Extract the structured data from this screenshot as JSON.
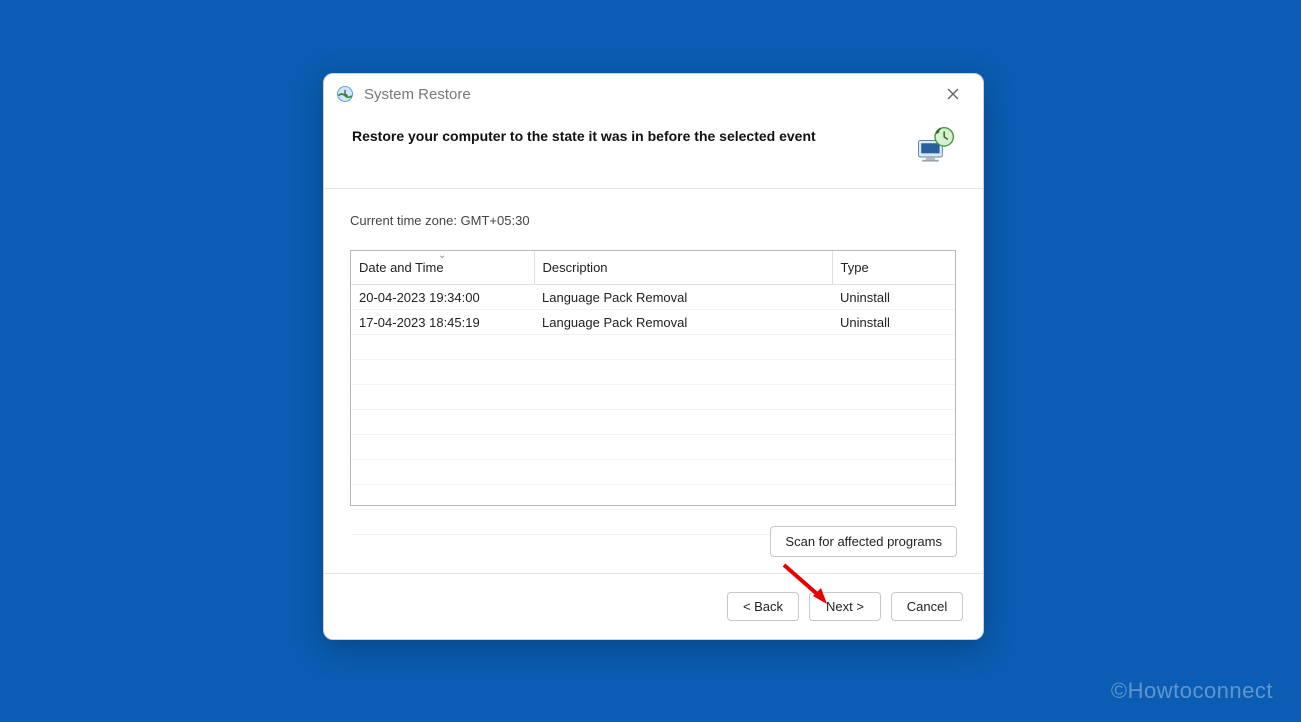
{
  "window": {
    "title": "System Restore"
  },
  "header": {
    "heading": "Restore your computer to the state it was in before the selected event"
  },
  "content": {
    "timezone_label": "Current time zone: GMT+05:30"
  },
  "table": {
    "columns": {
      "datetime": "Date and Time",
      "description": "Description",
      "type": "Type"
    },
    "rows": [
      {
        "datetime": "20-04-2023 19:34:00",
        "description": "Language Pack Removal",
        "type": "Uninstall"
      },
      {
        "datetime": "17-04-2023 18:45:19",
        "description": "Language Pack Removal",
        "type": "Uninstall"
      }
    ]
  },
  "buttons": {
    "scan": "Scan for affected programs",
    "back": "< Back",
    "next": "Next >",
    "cancel": "Cancel"
  },
  "watermark": "©Howtoconnect"
}
